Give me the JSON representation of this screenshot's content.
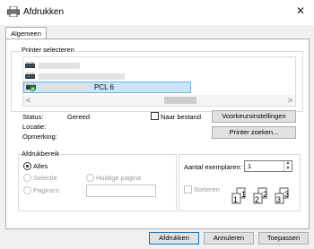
{
  "window": {
    "title": "Afdrukken",
    "close_glyph": "✕"
  },
  "tabs": [
    {
      "label": "Algemeen"
    }
  ],
  "printer_select": {
    "group_label": "Printer selecteren",
    "selected_printer_name": "PCL 6",
    "scroll_left": "<",
    "scroll_right": ">"
  },
  "status": {
    "status_label": "Status:",
    "status_value": "Gereed",
    "location_label": "Locatie:",
    "comment_label": "Opmerking:",
    "print_to_file_label": "Naar bestand",
    "preferences_button": "Voorkeursinstellingen",
    "find_printer_button": "Printer zoeken..."
  },
  "page_range": {
    "group_label": "Afdrukbereik",
    "all": "Alles",
    "selection": "Selectie",
    "current_page": "Huidige pagina",
    "pages": "Pagina's:",
    "selected": "all"
  },
  "copies": {
    "label": "Aantal exemplaren:",
    "value": "1",
    "collate_label": "Sorteren",
    "collate_icon_numbers": [
      "1",
      "1",
      "2",
      "2",
      "3",
      "3"
    ]
  },
  "buttons": {
    "print": "Afdrukken",
    "cancel": "Annuleren",
    "apply": "Toepassen"
  },
  "colors": {
    "selection_bg": "#cce4f7",
    "selection_border": "#6fb0e6",
    "primary_button_border": "#0078d7",
    "printer_icon_blue": "#1a6fb5",
    "ready_green": "#2e9e2e"
  }
}
